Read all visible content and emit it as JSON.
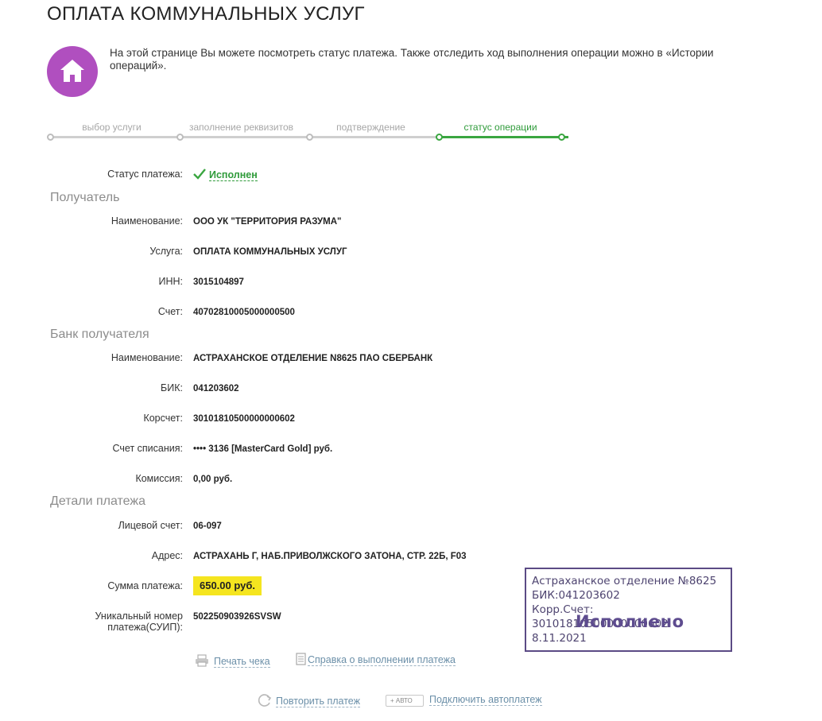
{
  "page": {
    "title": "ОПЛАТА КОММУНАЛЬНЫХ УСЛУГ",
    "intro": "На этой странице Вы можете посмотреть статус платежа. Также отследить ход выполнения операции можно в «Истории операций»."
  },
  "stepper": {
    "steps": [
      "выбор услуги",
      "заполнение реквизитов",
      "подтверждение",
      "статус операции"
    ],
    "active_index": 3
  },
  "status": {
    "label": "Статус платежа:",
    "value": "Исполнен"
  },
  "recipient": {
    "heading": "Получатель",
    "name_label": "Наименование:",
    "name": "ООО УК \"ТЕРРИТОРИЯ РАЗУМА\"",
    "service_label": "Услуга:",
    "service": "ОПЛАТА КОММУНАЛЬНЫХ УСЛУГ",
    "inn_label": "ИНН:",
    "inn": "3015104897",
    "account_label": "Счет:",
    "account": "40702810005000000500"
  },
  "bank": {
    "heading": "Банк получателя",
    "name_label": "Наименование:",
    "name": "АСТРАХАНСКОЕ ОТДЕЛЕНИЕ N8625 ПАО СБЕРБАНК",
    "bik_label": "БИК:",
    "bik": "041203602",
    "corr_label": "Корсчет:",
    "corr": "30101810500000000602",
    "debit_label": "Счет списания:",
    "debit": "•••• 3136  [MasterCard Gold]  руб.",
    "fee_label": "Комиссия:",
    "fee": "0,00 руб."
  },
  "details": {
    "heading": "Детали платежа",
    "personal_label": "Лицевой счет:",
    "personal": "06-097",
    "address_label": "Адрес:",
    "address": "АСТРАХАНЬ Г, НАБ.ПРИВОЛЖСКОГО ЗАТОНА, СТР. 22Б, F03",
    "amount_label": "Сумма платежа:",
    "amount": "650.00 руб.",
    "suip_label_1": "Уникальный номер",
    "suip_label_2": "платежа(СУИП):",
    "suip": "502250903926SVSW"
  },
  "actions": {
    "print": "Печать чека",
    "certificate": "Справка о выполнении платежа",
    "repeat": "Повторить платеж",
    "auto_badge": "+ АВТО",
    "autopay": "Подключить автоплатеж"
  },
  "stamp": {
    "line1": "Астраханское отделение №8625",
    "line2": "БИК:041203602",
    "line3": "Корр.Счет: 30101810500000000602",
    "word": "Исполнено",
    "date": "8.11.2021"
  },
  "colors": {
    "accent_green": "#3aa640",
    "badge_purple": "#b04fbf",
    "highlight_yellow": "#f5e51f",
    "stamp_purple": "#5b4b85"
  }
}
